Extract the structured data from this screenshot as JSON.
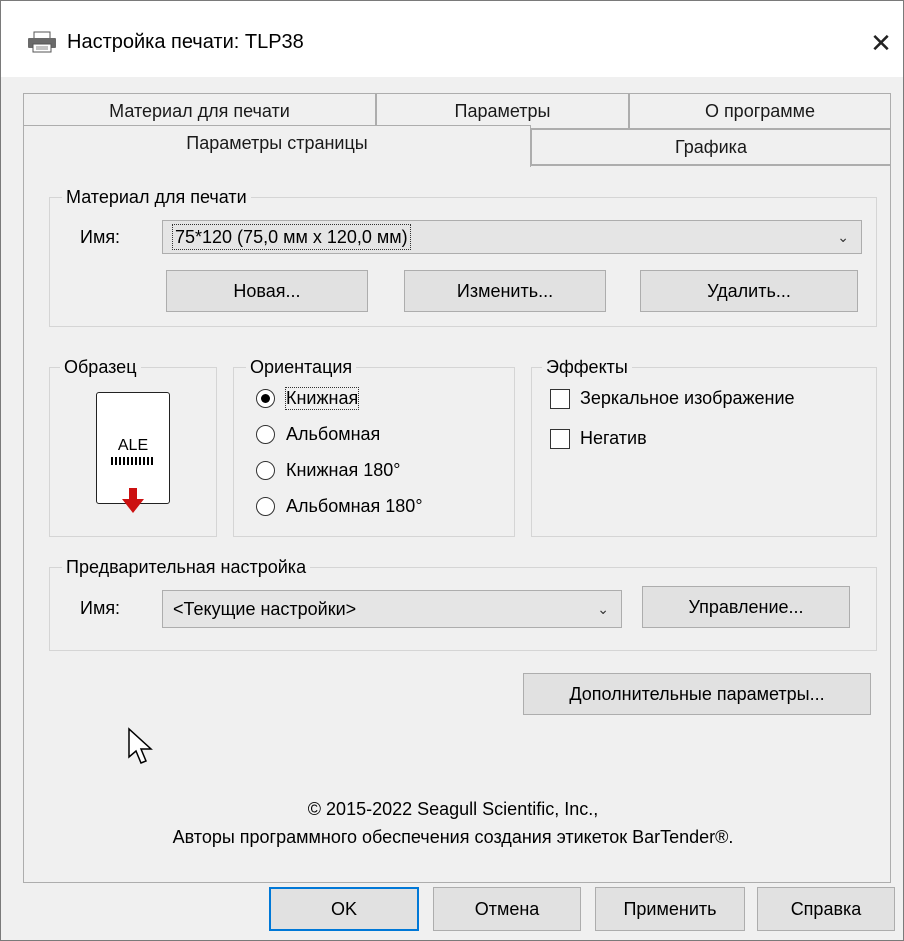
{
  "window": {
    "title": "Настройка печати: TLP38",
    "icon": "printer-icon",
    "close_glyph": "✕"
  },
  "tabs": {
    "row_back": [
      "Материал для печати",
      "Параметры",
      "О программе"
    ],
    "row_front": [
      "Параметры страницы",
      "Графика"
    ],
    "active": "Параметры страницы"
  },
  "media": {
    "group_label": "Материал для печати",
    "name_label": "Имя:",
    "name_value": "75*120 (75,0 мм x 120,0 мм)",
    "buttons": {
      "new": "Новая...",
      "edit": "Изменить...",
      "delete": "Удалить..."
    }
  },
  "sample": {
    "group_label": "Образец",
    "preview_text": "ALE",
    "barcode_glyph": "||||||||||"
  },
  "orientation": {
    "group_label": "Ориентация",
    "options": [
      "Книжная",
      "Альбомная",
      "Книжная 180°",
      "Альбомная 180°"
    ],
    "selected": "Книжная"
  },
  "effects": {
    "group_label": "Эффекты",
    "mirror": {
      "label": "Зеркальное изображение",
      "checked": false
    },
    "negative": {
      "label": "Негатив",
      "checked": false
    }
  },
  "preset": {
    "group_label": "Предварительная настройка",
    "name_label": "Имя:",
    "name_value": "<Текущие настройки>",
    "manage_button": "Управление..."
  },
  "advanced_button": "Дополнительные параметры...",
  "copyright": {
    "line1": "© 2015-2022 Seagull Scientific, Inc.,",
    "line2": "Авторы программного обеспечения создания этикеток BarTender®."
  },
  "footer_buttons": {
    "ok": "OK",
    "cancel": "Отмена",
    "apply": "Применить",
    "help": "Справка"
  },
  "colors": {
    "accent": "#0078d7",
    "arrow": "#cc1111",
    "panel_bg": "#f0f0f0"
  }
}
